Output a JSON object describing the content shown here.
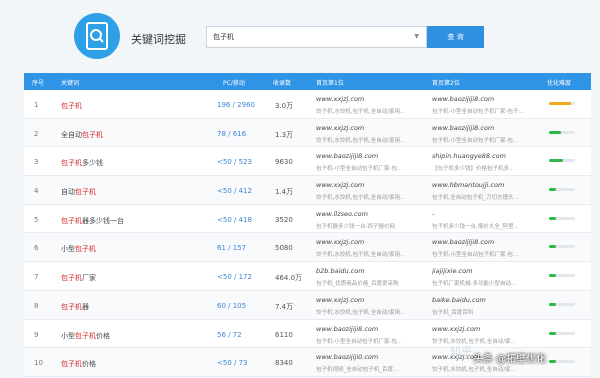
{
  "header": {
    "title": "关键词挖掘",
    "search_value": "包子机",
    "query_label": "查 询"
  },
  "columns": [
    "序号",
    "关键词",
    "PC/移动",
    "收录数",
    "首页第1位",
    "首页第2位",
    "优化难度"
  ],
  "rows": [
    {
      "idx": "1",
      "kw_pre": "",
      "kw_hl": "包子机",
      "kw_post": "",
      "pc": "196 / 2960",
      "vol": "3.0万",
      "u1": "www.xxjzj.com",
      "s1": "饺子机,水饺机,包子机,全自动/家用...",
      "u2": "www.baozijiji8.com",
      "s2": "包子机-小型全自动包子机厂家-包子...",
      "diff": 0.85,
      "color": "#f0a81c"
    },
    {
      "idx": "2",
      "kw_pre": "全自动",
      "kw_hl": "包子机",
      "kw_post": "",
      "pc": "78 / 616",
      "vol": "1.3万",
      "u1": "www.xxjzj.com",
      "s1": "饺子机,水饺机,包子机,全自动/家用...",
      "u2": "www.baozijiji8.com",
      "s2": "包子机-小型全自动包子机厂家-包...",
      "diff": 0.45,
      "color": "#2fb74a"
    },
    {
      "idx": "3",
      "kw_pre": "",
      "kw_hl": "包子机",
      "kw_post": "多少钱",
      "pc": "<50 / 523",
      "vol": "9630",
      "u1": "www.baozijiji8.com",
      "s1": "包子机-小型全自动包子机厂家-包...",
      "u2": "shipin.huangye88.com",
      "s2": "【包子机多少钱】价格包子机多...",
      "diff": 0.55,
      "color": "#2fb74a"
    },
    {
      "idx": "4",
      "kw_pre": "自动",
      "kw_hl": "包子机",
      "kw_post": "",
      "pc": "<50 / 412",
      "vol": "1.4万",
      "u1": "www.xxjzj.com",
      "s1": "饺子机,水饺机,包子机,全自动/家用...",
      "u2": "www.hbmantoujji.com",
      "s2": "包子机,全自动包子机_刀切方馒头...",
      "diff": 0.25,
      "color": "#2fb74a"
    },
    {
      "idx": "5",
      "kw_pre": "",
      "kw_hl": "包子机",
      "kw_post": "器多少钱一台",
      "pc": "<50 / 418",
      "vol": "3520",
      "u1": "www.llzseo.com",
      "s1": "包子机器多少钱一台-西子报价网",
      "u2": "-",
      "s2": "包子机多少钱一台,报价大全_阿里...",
      "diff": 0.25,
      "color": "#2fb74a"
    },
    {
      "idx": "6",
      "kw_pre": "小型",
      "kw_hl": "包子机",
      "kw_post": "",
      "pc": "61 / 157",
      "vol": "5080",
      "u1": "www.xxjzj.com",
      "s1": "饺子机,水饺机,包子机,全自动/家用...",
      "u2": "www.baozijiji8.com",
      "s2": "包子机-小型全自动包子机厂家-包...",
      "diff": 0.25,
      "color": "#2fb74a"
    },
    {
      "idx": "7",
      "kw_pre": "",
      "kw_hl": "包子机",
      "kw_post": "厂家",
      "pc": "<50 / 172",
      "vol": "464.0万",
      "u1": "b2b.baidu.com",
      "s1": "包子机_优质商品价格_百度爱采购",
      "u2": "jiajijixie.com",
      "s2": "包子机厂家机械-多功能小型自动...",
      "diff": 0.25,
      "color": "#2fb74a"
    },
    {
      "idx": "8",
      "kw_pre": "",
      "kw_hl": "包子机",
      "kw_post": "器",
      "pc": "60 / 105",
      "vol": "7.4万",
      "u1": "www.xxjzj.com",
      "s1": "饺子机,水饺机,包子机,全自动/家用...",
      "u2": "baike.baidu.com",
      "s2": "包子机_百度百科",
      "diff": 0.25,
      "color": "#2fb74a"
    },
    {
      "idx": "9",
      "kw_pre": "小型",
      "kw_hl": "包子机",
      "kw_post": "价格",
      "pc": "56 / 72",
      "vol": "6110",
      "u1": "www.baozijiji8.com",
      "s1": "包子机-小型全自动包子机厂家-包...",
      "u2": "www.xxjzj.com",
      "s2": "饺子机,水饺机,包子机,全自动/家...",
      "diff": 0.25,
      "color": "#2fb74a"
    },
    {
      "idx": "10",
      "kw_pre": "",
      "kw_hl": "包子机",
      "kw_post": "价格",
      "pc": "<50 / 73",
      "vol": "8340",
      "u1": "www.baozijiji0.com",
      "s1": "包子机视频_全自动包子机_百度...",
      "u2": "www.xxjzj.com",
      "s2": "饺子机,水饺机,包子机,全自动/家...",
      "diff": 0.25,
      "color": "#2fb74a"
    }
  ],
  "watermark": {
    "line1": "知乎",
    "line2": "头条 @拓壁优化"
  }
}
